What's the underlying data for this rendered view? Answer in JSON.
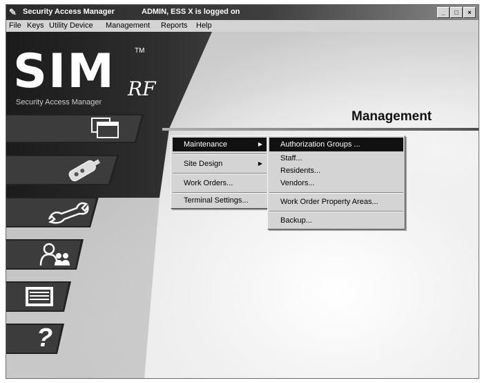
{
  "window": {
    "title": "Security Access Manager",
    "status": "ADMIN, ESS X is logged on",
    "controls": {
      "minimize": "_",
      "maximize": "□",
      "close": "×"
    }
  },
  "menubar": [
    "File",
    "Keys",
    "Utility Device",
    "Management",
    "Reports",
    "Help"
  ],
  "logo": {
    "letters": "SIM",
    "tm": "TM",
    "rf": "RF",
    "subtitle": "Security Access Manager"
  },
  "nav_buttons": [
    {
      "name": "folders",
      "icon": "folders-icon"
    },
    {
      "name": "key",
      "icon": "key-device-icon"
    },
    {
      "name": "wrench",
      "icon": "wrench-icon"
    },
    {
      "name": "people",
      "icon": "people-icon"
    },
    {
      "name": "reports",
      "icon": "list-icon"
    },
    {
      "name": "help",
      "icon": "question-icon",
      "glyph": "?"
    }
  ],
  "section_title": "Management",
  "management_menu": {
    "items": [
      {
        "label": "Maintenance",
        "submenu": true,
        "active": true
      },
      {
        "label": "Site Design",
        "submenu": true
      },
      {
        "label": "Work Orders...",
        "submenu": false
      },
      {
        "label": "Terminal Settings...",
        "submenu": false
      }
    ]
  },
  "maintenance_submenu": {
    "items": [
      {
        "label": "Authorization Groups ...",
        "active": true
      },
      {
        "label": "Staff..."
      },
      {
        "label": "Residents..."
      },
      {
        "label": "Vendors..."
      },
      {
        "label": "Work Order Property Areas..."
      },
      {
        "label": "Backup..."
      }
    ]
  },
  "colors": {
    "menu_highlight": "#111111",
    "menu_bg": "#d4d4d4",
    "titlebar": "#2a2a2a"
  }
}
